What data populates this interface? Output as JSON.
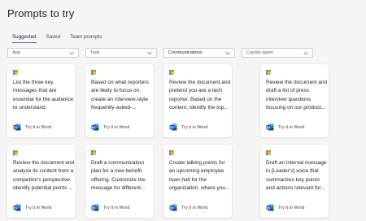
{
  "page": {
    "title": "Prompts to try"
  },
  "tabs": [
    {
      "label": "Suggested",
      "active": true
    },
    {
      "label": "Saved",
      "active": false
    },
    {
      "label": "Team prompts",
      "active": false
    }
  ],
  "filters": [
    {
      "label": "App",
      "selected": false
    },
    {
      "label": "Task",
      "selected": false
    },
    {
      "label": "Communications",
      "selected": true
    },
    {
      "label": "Copilot agent",
      "selected": false
    }
  ],
  "colors": {
    "accent": "#5b5fc7",
    "word_blue": "#185abd",
    "logo": [
      "#f25022",
      "#7fba00",
      "#00a4ef",
      "#ffb900"
    ]
  },
  "cards": [
    {
      "lines": [
        "List the three key",
        "messages that are",
        "essential for the audience",
        "to understand."
      ],
      "footer": "Try it in Word",
      "icon": "word-icon"
    },
    {
      "lines": [
        "Based on what reporters",
        "are likely to focus on,",
        "create an interview-style",
        "frequently-asked-..."
      ],
      "footer": "Try it in Word",
      "icon": "word-icon"
    },
    {
      "lines": [
        "Review the document and",
        "pretend you are a tech",
        "reporter. Based on the",
        "content, identify the top..."
      ],
      "footer": "Try it in Word",
      "icon": "word-icon"
    },
    {
      "lines": [
        "Review the document and",
        "draft a list of press",
        "interview questions",
        "focusing on our product..."
      ],
      "footer": "Try it in Word",
      "icon": "word-icon"
    },
    {
      "lines": [
        "Review the document and",
        "analyze its content from a",
        "competitor's perspective.",
        "Identify potential points ..."
      ],
      "footer": "Try it in Word",
      "icon": "word-icon"
    },
    {
      "lines": [
        "Draft a communication",
        "plan for a new benefit",
        "offering. Customize the",
        "message for different..."
      ],
      "footer": "Try it in Word",
      "icon": "word-icon"
    },
    {
      "lines": [
        "Create talking points for",
        "an upcoming employee",
        "town hall for the",
        "organization, where you..."
      ],
      "footer": "Try it in Word",
      "icon": "word-icon"
    },
    {
      "lines": [
        "Draft an internal message",
        "in [Leader's] voice that",
        "summarizes key points",
        "and actions relevant for..."
      ],
      "footer": "Try it in Word",
      "icon": "word-icon"
    }
  ]
}
